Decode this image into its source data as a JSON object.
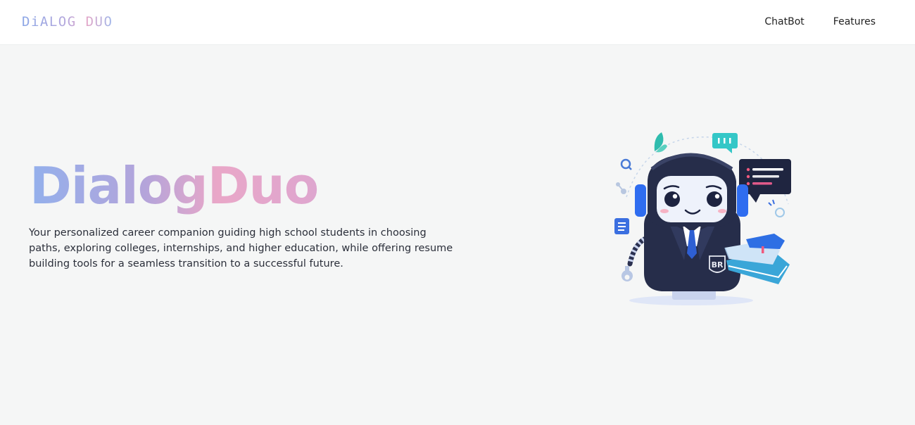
{
  "header": {
    "logo": "DiALOG DUO",
    "nav": [
      {
        "label": "ChatBot"
      },
      {
        "label": "Features"
      }
    ]
  },
  "hero": {
    "title": "DialogDuo",
    "description": "Your personalized career companion guiding high school students in choosing paths, exploring colleges, internships, and higher education, while offering resume building tools for a seamless transition to a successful future.",
    "illustration": {
      "badge": "BR"
    }
  },
  "colors": {
    "gradient_start": "#93b0ec",
    "gradient_end": "#e9a7c8",
    "robot_body": "#262d4a",
    "accent_blue": "#3b6fe0",
    "accent_teal": "#3fc9c9"
  }
}
